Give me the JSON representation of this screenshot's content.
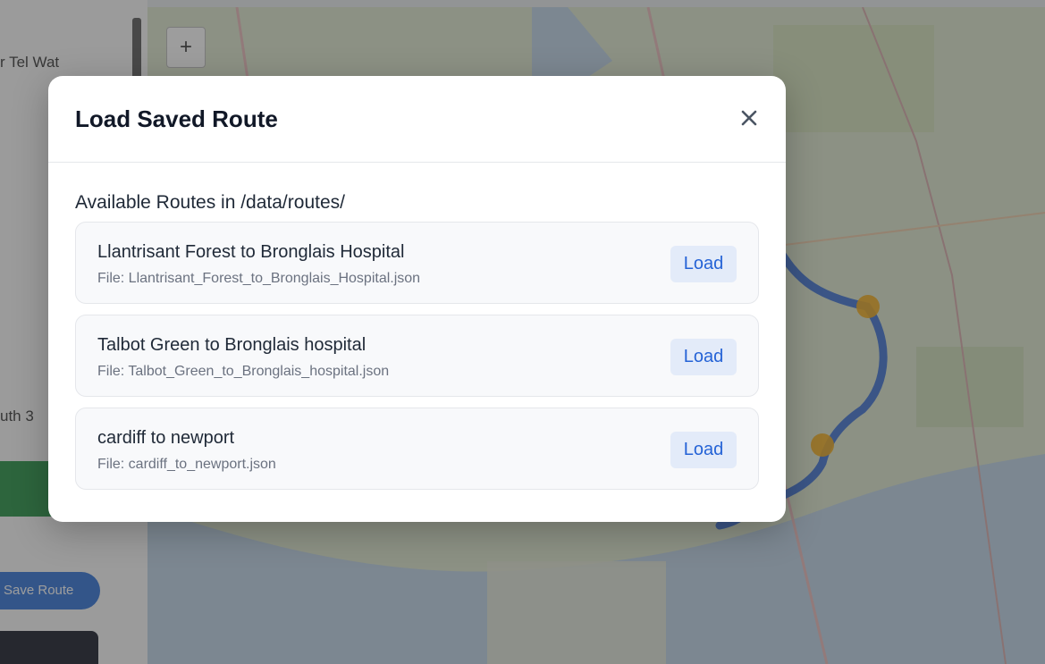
{
  "sidebar": {
    "text_top": "r Tel Wat",
    "text_mid": "uth 3",
    "blue_button_label": "Save Route"
  },
  "map": {
    "zoom_in_label": "+",
    "route_color": "#3b6fd1",
    "marker_color": "#f2a50c"
  },
  "modal": {
    "title": "Load Saved Route",
    "close_label": "Close",
    "section_label": "Available Routes in /data/routes/",
    "routes": [
      {
        "name": "Llantrisant Forest to Bronglais Hospital",
        "file": "File: Llantrisant_Forest_to_Bronglais_Hospital.json",
        "load_label": "Load"
      },
      {
        "name": "Talbot Green to Bronglais hospital",
        "file": "File: Talbot_Green_to_Bronglais_hospital.json",
        "load_label": "Load"
      },
      {
        "name": "cardiff to newport",
        "file": "File: cardiff_to_newport.json",
        "load_label": "Load"
      }
    ]
  },
  "colors": {
    "accent": "#2563d6",
    "button_bg": "#e3ebf9",
    "overlay": "rgba(60,60,60,0.5)"
  }
}
